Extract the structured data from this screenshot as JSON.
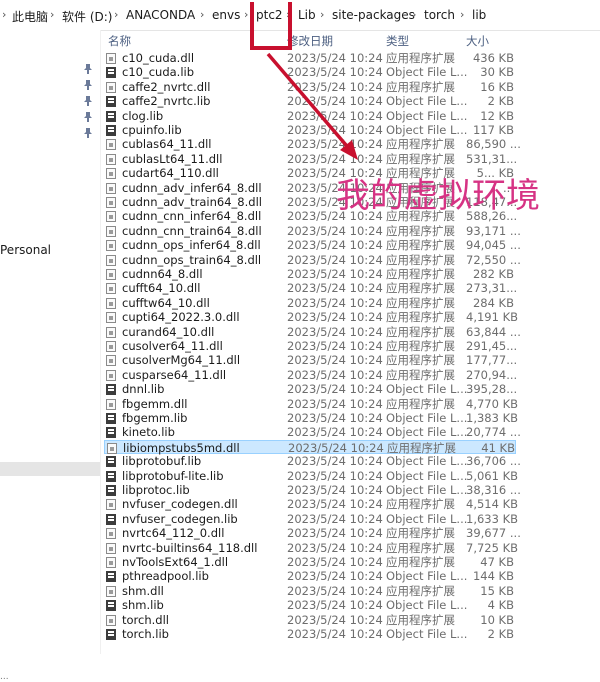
{
  "breadcrumb": {
    "items": [
      "此电脑",
      "软件 (D:)",
      "ANACONDA",
      "envs",
      "ptc2",
      "Lib",
      "site-packages",
      "torch",
      "lib"
    ]
  },
  "nav": {
    "personal_label": "Personal",
    "bottom_label": "..."
  },
  "columns": {
    "name": "名称",
    "date": "修改日期",
    "type": "类型",
    "size": "大小"
  },
  "files": [
    {
      "name": "c10_cuda.dll",
      "date": "2023/5/24 10:24",
      "type": "应用程序扩展",
      "size": "436 KB",
      "icon": "dll"
    },
    {
      "name": "c10_cuda.lib",
      "date": "2023/5/24 10:24",
      "type": "Object File L...",
      "size": "30 KB",
      "icon": "lib"
    },
    {
      "name": "caffe2_nvrtc.dll",
      "date": "2023/5/24 10:24",
      "type": "应用程序扩展",
      "size": "16 KB",
      "icon": "dll"
    },
    {
      "name": "caffe2_nvrtc.lib",
      "date": "2023/5/24 10:24",
      "type": "Object File L...",
      "size": "2 KB",
      "icon": "lib"
    },
    {
      "name": "clog.lib",
      "date": "2023/5/24 10:24",
      "type": "Object File L...",
      "size": "12 KB",
      "icon": "lib"
    },
    {
      "name": "cpuinfo.lib",
      "date": "2023/5/24 10:24",
      "type": "Object File L...",
      "size": "117 KB",
      "icon": "lib"
    },
    {
      "name": "cublas64_11.dll",
      "date": "2023/5/24 10:24",
      "type": "应用程序扩展",
      "size": "86,590 ...",
      "icon": "dll"
    },
    {
      "name": "cublasLt64_11.dll",
      "date": "2023/5/24 10:24",
      "type": "应用程序扩展",
      "size": "531,31...",
      "icon": "dll"
    },
    {
      "name": "cudart64_110.dll",
      "date": "2023/5/24 10:24",
      "type": "应用程序扩展",
      "size": "5... KB",
      "icon": "dll"
    },
    {
      "name": "cudnn_adv_infer64_8.dll",
      "date": "2023/5/24 10:24",
      "type": "应用程序扩展",
      "size": "...",
      "icon": "dll"
    },
    {
      "name": "cudnn_adv_train64_8.dll",
      "date": "2023/5/24 10:24",
      "type": "应用程序扩展",
      "size": "118,47...",
      "icon": "dll"
    },
    {
      "name": "cudnn_cnn_infer64_8.dll",
      "date": "2023/5/24 10:24",
      "type": "应用程序扩展",
      "size": "588,26...",
      "icon": "dll"
    },
    {
      "name": "cudnn_cnn_train64_8.dll",
      "date": "2023/5/24 10:24",
      "type": "应用程序扩展",
      "size": "93,171 ...",
      "icon": "dll"
    },
    {
      "name": "cudnn_ops_infer64_8.dll",
      "date": "2023/5/24 10:24",
      "type": "应用程序扩展",
      "size": "94,045 ...",
      "icon": "dll"
    },
    {
      "name": "cudnn_ops_train64_8.dll",
      "date": "2023/5/24 10:24",
      "type": "应用程序扩展",
      "size": "72,550 ...",
      "icon": "dll"
    },
    {
      "name": "cudnn64_8.dll",
      "date": "2023/5/24 10:24",
      "type": "应用程序扩展",
      "size": "282 KB",
      "icon": "dll"
    },
    {
      "name": "cufft64_10.dll",
      "date": "2023/5/24 10:24",
      "type": "应用程序扩展",
      "size": "273,31...",
      "icon": "dll"
    },
    {
      "name": "cufftw64_10.dll",
      "date": "2023/5/24 10:24",
      "type": "应用程序扩展",
      "size": "284 KB",
      "icon": "dll"
    },
    {
      "name": "cupti64_2022.3.0.dll",
      "date": "2023/5/24 10:24",
      "type": "应用程序扩展",
      "size": "4,191 KB",
      "icon": "dll"
    },
    {
      "name": "curand64_10.dll",
      "date": "2023/5/24 10:24",
      "type": "应用程序扩展",
      "size": "63,844 ...",
      "icon": "dll"
    },
    {
      "name": "cusolver64_11.dll",
      "date": "2023/5/24 10:24",
      "type": "应用程序扩展",
      "size": "291,45...",
      "icon": "dll"
    },
    {
      "name": "cusolverMg64_11.dll",
      "date": "2023/5/24 10:24",
      "type": "应用程序扩展",
      "size": "177,77...",
      "icon": "dll"
    },
    {
      "name": "cusparse64_11.dll",
      "date": "2023/5/24 10:24",
      "type": "应用程序扩展",
      "size": "270,94...",
      "icon": "dll"
    },
    {
      "name": "dnnl.lib",
      "date": "2023/5/24 10:24",
      "type": "Object File L...",
      "size": "395,28...",
      "icon": "lib"
    },
    {
      "name": "fbgemm.dll",
      "date": "2023/5/24 10:24",
      "type": "应用程序扩展",
      "size": "4,770 KB",
      "icon": "dll"
    },
    {
      "name": "fbgemm.lib",
      "date": "2023/5/24 10:24",
      "type": "Object File L...",
      "size": "1,383 KB",
      "icon": "lib"
    },
    {
      "name": "kineto.lib",
      "date": "2023/5/24 10:24",
      "type": "Object File L...",
      "size": "20,774 ...",
      "icon": "lib"
    },
    {
      "name": "libiompstubs5md.dll",
      "date": "2023/5/24 10:24",
      "type": "应用程序扩展",
      "size": "41 KB",
      "icon": "dll",
      "selected": true
    },
    {
      "name": "libprotobuf.lib",
      "date": "2023/5/24 10:24",
      "type": "Object File L...",
      "size": "36,706 ...",
      "icon": "lib"
    },
    {
      "name": "libprotobuf-lite.lib",
      "date": "2023/5/24 10:24",
      "type": "Object File L...",
      "size": "5,061 KB",
      "icon": "lib"
    },
    {
      "name": "libprotoc.lib",
      "date": "2023/5/24 10:24",
      "type": "Object File L...",
      "size": "38,316 ...",
      "icon": "lib"
    },
    {
      "name": "nvfuser_codegen.dll",
      "date": "2023/5/24 10:24",
      "type": "应用程序扩展",
      "size": "4,514 KB",
      "icon": "dll"
    },
    {
      "name": "nvfuser_codegen.lib",
      "date": "2023/5/24 10:24",
      "type": "Object File L...",
      "size": "1,633 KB",
      "icon": "lib"
    },
    {
      "name": "nvrtc64_112_0.dll",
      "date": "2023/5/24 10:24",
      "type": "应用程序扩展",
      "size": "39,677 ...",
      "icon": "dll"
    },
    {
      "name": "nvrtc-builtins64_118.dll",
      "date": "2023/5/24 10:24",
      "type": "应用程序扩展",
      "size": "7,725 KB",
      "icon": "dll"
    },
    {
      "name": "nvToolsExt64_1.dll",
      "date": "2023/5/24 10:24",
      "type": "应用程序扩展",
      "size": "47 KB",
      "icon": "dll"
    },
    {
      "name": "pthreadpool.lib",
      "date": "2023/5/24 10:24",
      "type": "Object File L...",
      "size": "144 KB",
      "icon": "lib"
    },
    {
      "name": "shm.dll",
      "date": "2023/5/24 10:24",
      "type": "应用程序扩展",
      "size": "15 KB",
      "icon": "dll"
    },
    {
      "name": "shm.lib",
      "date": "2023/5/24 10:24",
      "type": "Object File L...",
      "size": "4 KB",
      "icon": "lib"
    },
    {
      "name": "torch.dll",
      "date": "2023/5/24 10:24",
      "type": "应用程序扩展",
      "size": "10 KB",
      "icon": "dll"
    },
    {
      "name": "torch.lib",
      "date": "2023/5/24 10:24",
      "type": "Object File L...",
      "size": "2 KB",
      "icon": "lib"
    }
  ],
  "annotation": {
    "text": "我的虚拟环境",
    "color": "#d63384"
  }
}
